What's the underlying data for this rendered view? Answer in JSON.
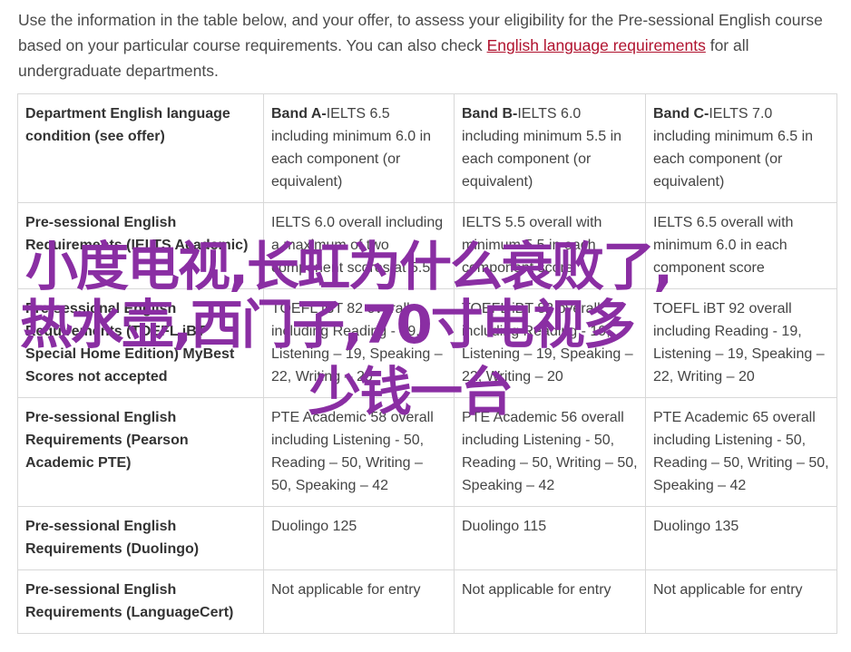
{
  "intro": {
    "text_before": "Use the information in the table below, and your offer, to assess your eligibility for the Pre-sessional English course based on your particular course requirements. You can also check ",
    "link": "English language requirements",
    "text_after": " for all undergraduate departments."
  },
  "table": {
    "header": {
      "label": "Department English language condition (see offer)",
      "bands": [
        {
          "name": "Band A-",
          "text": "IELTS 6.5 including minimum 6.0 in each component (or equivalent)"
        },
        {
          "name": "Band B-",
          "text": "IELTS 6.0 including minimum 5.5 in each component (or equivalent)"
        },
        {
          "name": "Band C-",
          "text": "IELTS 7.0 including minimum 6.5 in each component (or equivalent)"
        }
      ]
    },
    "rows": [
      {
        "label": "Pre-sessional English Requirements (IELTS Academic)",
        "cells": [
          "IELTS 6.0 overall including a maximum of two component scores at 5.5",
          "IELTS 5.5 overall with minimum 5.5 in each component score",
          "IELTS 6.5 overall with minimum 6.0 in each component score"
        ]
      },
      {
        "label": "Pre-sessional English Requirements (TOEFL iBT Special Home Edition) MyBest Scores not accepted",
        "cells": [
          "TOEFL iBT 82 overall including Reading - 19, Listening – 19, Speaking – 22, Writing – 20",
          "TOEFL iBT 82 overall including Reading - 19, Listening – 19, Speaking – 22, Writing – 20",
          "TOEFL iBT 92 overall including Reading - 19, Listening – 19, Speaking – 22, Writing – 20"
        ]
      },
      {
        "label": "Pre-sessional English Requirements (Pearson Academic PTE)",
        "cells": [
          "PTE Academic 58 overall including Listening - 50, Reading – 50, Writing – 50, Speaking – 42",
          "PTE Academic 56 overall including Listening - 50, Reading – 50, Writing – 50, Speaking – 42",
          "PTE Academic 65 overall including Listening - 50, Reading – 50, Writing – 50, Speaking – 42"
        ]
      },
      {
        "label": "Pre-sessional English Requirements (Duolingo)",
        "cells": [
          "Duolingo 125",
          "Duolingo 115",
          "Duolingo 135"
        ]
      },
      {
        "label": "Pre-sessional English Requirements (LanguageCert)",
        "cells": [
          "Not applicable for entry",
          "Not applicable for entry",
          "Not applicable for entry"
        ]
      }
    ]
  },
  "watermark": {
    "line1": "小度电视,长虹为什么衰败了,",
    "line2": "热水壶,西门子,70寸电视多",
    "line3": "少钱一台",
    "color": "#8a2ea3"
  }
}
